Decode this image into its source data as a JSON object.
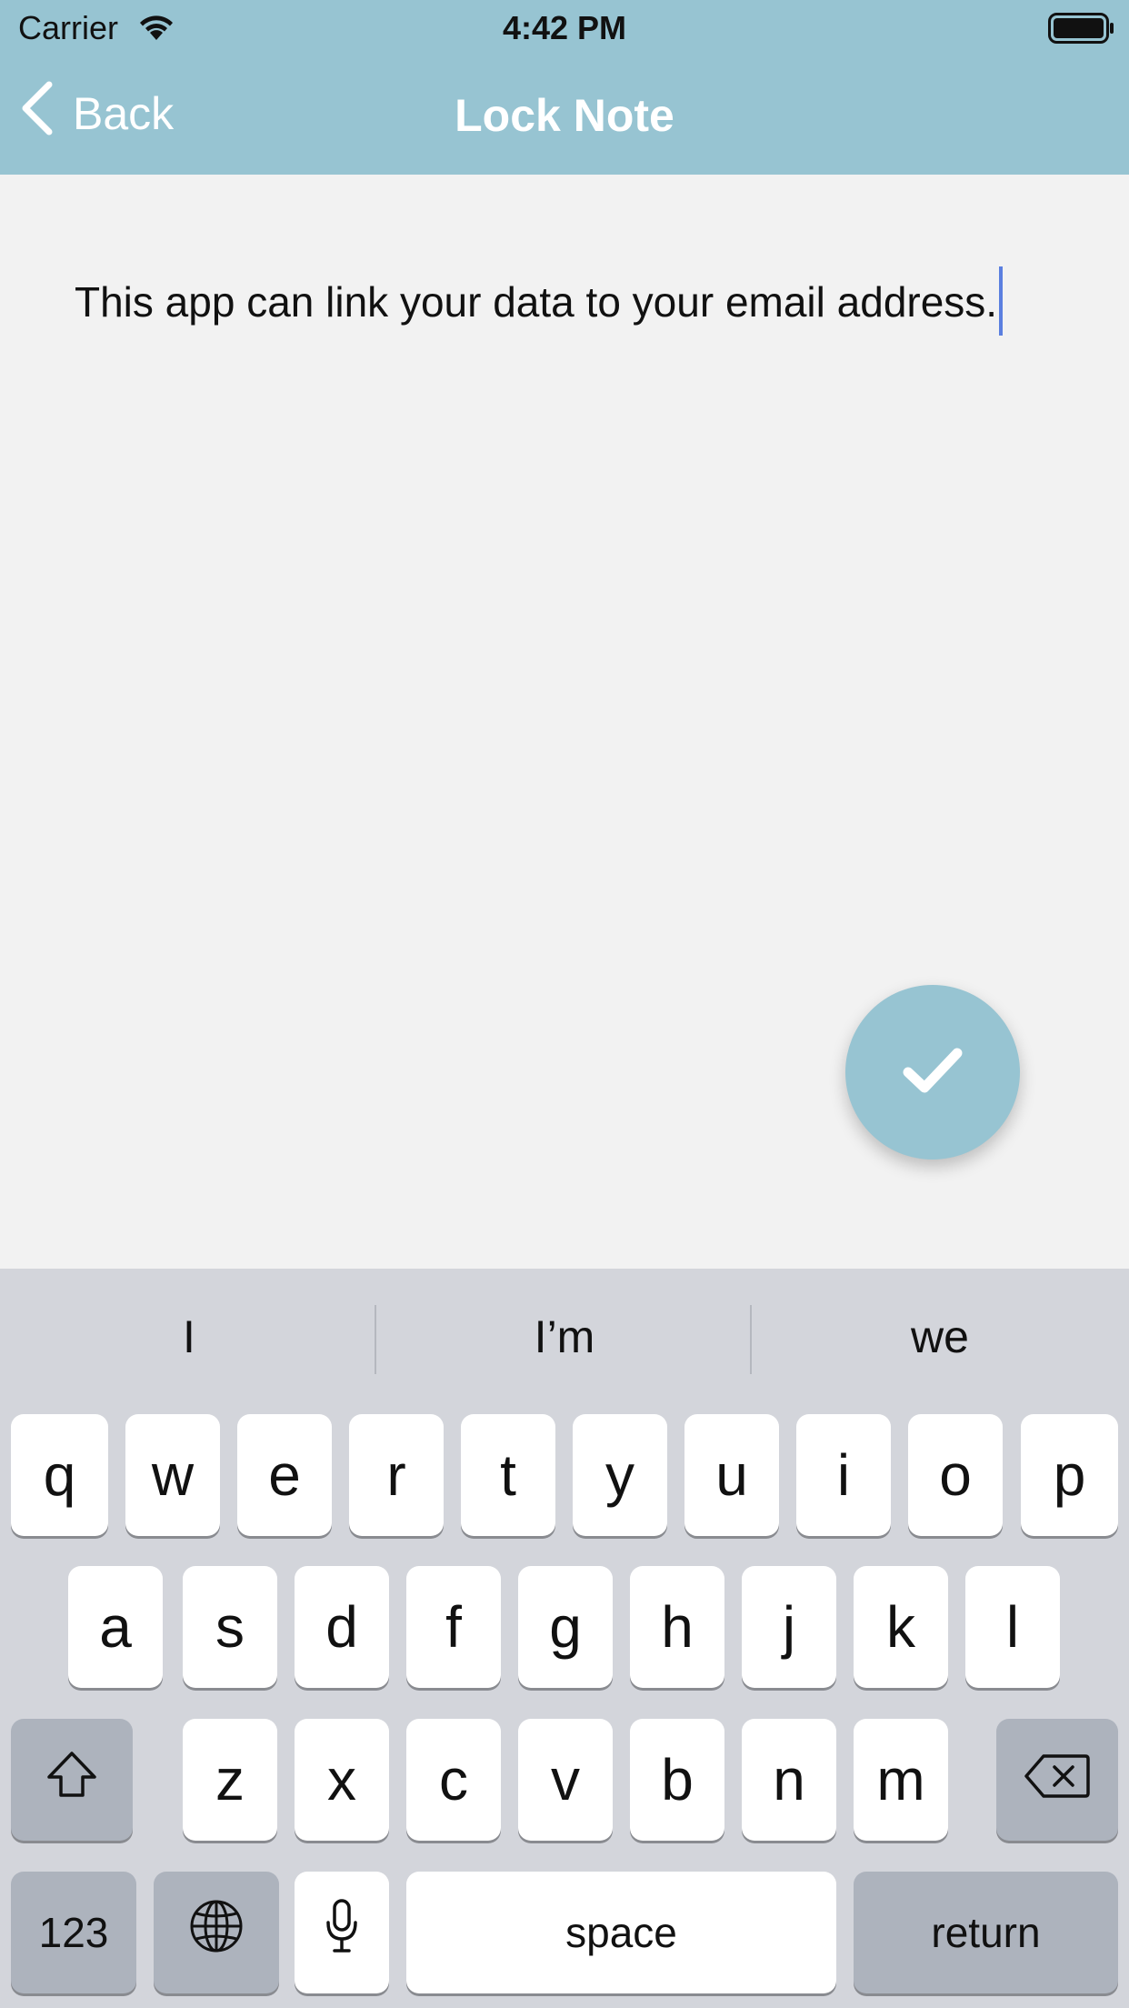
{
  "status_bar": {
    "carrier": "Carrier",
    "time": "4:42 PM"
  },
  "nav": {
    "back_label": "Back",
    "title": "Lock Note"
  },
  "note": {
    "text": "This app can link your data to your email address."
  },
  "fab": {
    "icon": "checkmark-icon"
  },
  "keyboard": {
    "suggestions": [
      "I",
      "I’m",
      "we"
    ],
    "row1": [
      "q",
      "w",
      "e",
      "r",
      "t",
      "y",
      "u",
      "i",
      "o",
      "p"
    ],
    "row2": [
      "a",
      "s",
      "d",
      "f",
      "g",
      "h",
      "j",
      "k",
      "l"
    ],
    "row3": [
      "z",
      "x",
      "c",
      "v",
      "b",
      "n",
      "m"
    ],
    "numbers_label": "123",
    "space_label": "space",
    "return_label": "return"
  },
  "colors": {
    "header": "#97c4d2",
    "background": "#f2f2f2",
    "keyboard": "#d3d5db",
    "caret": "#5b7fe0"
  }
}
